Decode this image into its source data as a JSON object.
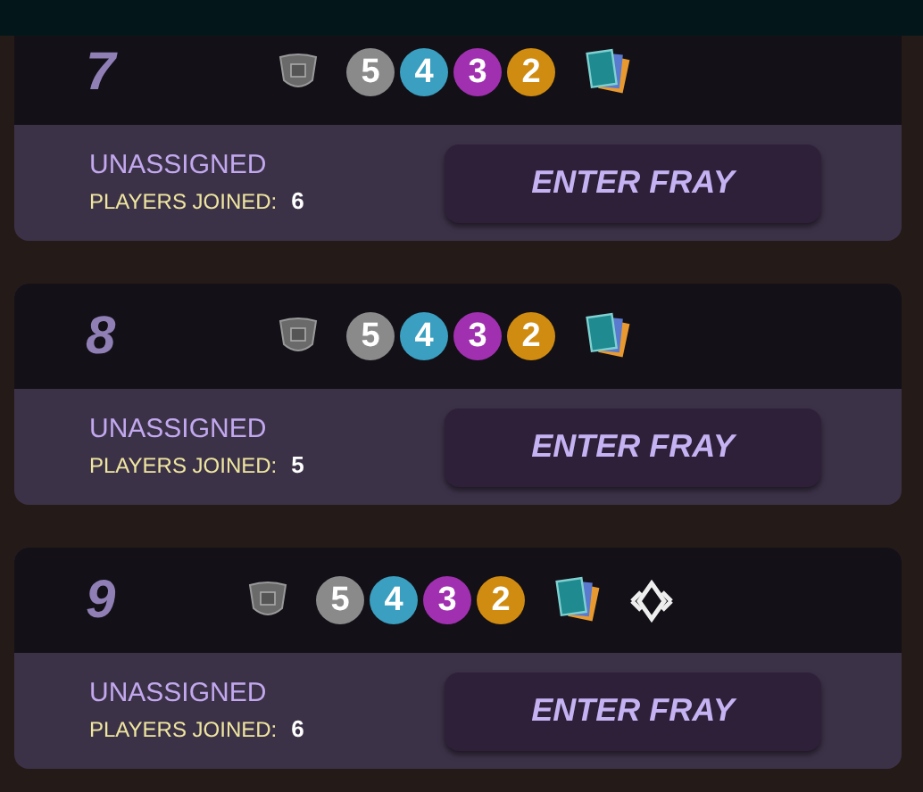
{
  "brawls": [
    {
      "number": "7",
      "icons": [
        {
          "kind": "shield"
        },
        {
          "kind": "badge",
          "text": "5",
          "color": "#8a8a8a"
        },
        {
          "kind": "badge",
          "text": "4",
          "color": "#3a9fc0"
        },
        {
          "kind": "badge",
          "text": "3",
          "color": "#a030b0"
        },
        {
          "kind": "badge",
          "text": "2",
          "color": "#d08c10"
        },
        {
          "kind": "cards"
        }
      ],
      "status": "UNASSIGNED",
      "players_label": "PLAYERS JOINED:",
      "players_count": "6",
      "button": "ENTER FRAY"
    },
    {
      "number": "8",
      "icons": [
        {
          "kind": "shield"
        },
        {
          "kind": "badge",
          "text": "5",
          "color": "#8a8a8a"
        },
        {
          "kind": "badge",
          "text": "4",
          "color": "#3a9fc0"
        },
        {
          "kind": "badge",
          "text": "3",
          "color": "#a030b0"
        },
        {
          "kind": "badge",
          "text": "2",
          "color": "#d08c10"
        },
        {
          "kind": "cards"
        }
      ],
      "status": "UNASSIGNED",
      "players_label": "PLAYERS JOINED:",
      "players_count": "5",
      "button": "ENTER FRAY"
    },
    {
      "number": "9",
      "icons": [
        {
          "kind": "shield"
        },
        {
          "kind": "badge",
          "text": "5",
          "color": "#8a8a8a"
        },
        {
          "kind": "badge",
          "text": "4",
          "color": "#3a9fc0"
        },
        {
          "kind": "badge",
          "text": "3",
          "color": "#a030b0"
        },
        {
          "kind": "badge",
          "text": "2",
          "color": "#d08c10"
        },
        {
          "kind": "cards"
        },
        {
          "kind": "diamond"
        }
      ],
      "status": "UNASSIGNED",
      "players_label": "PLAYERS JOINED:",
      "players_count": "6",
      "button": "ENTER FRAY"
    }
  ]
}
